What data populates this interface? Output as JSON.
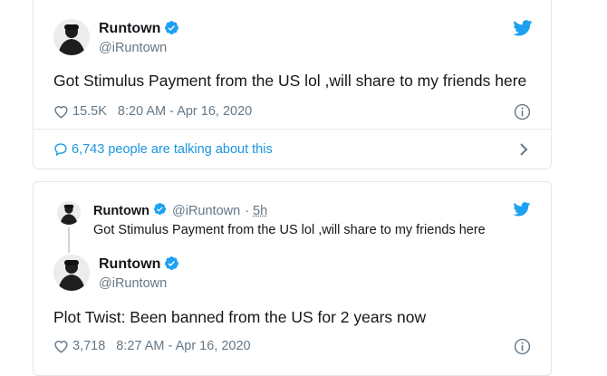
{
  "tweet1": {
    "name": "Runtown",
    "handle": "@iRuntown",
    "text": "Got Stimulus Payment from the US lol ,will share to my friends here",
    "likes": "15.5K",
    "timestamp": "8:20 AM - Apr 16, 2020",
    "talking": "6,743 people are talking about this"
  },
  "tweet2": {
    "quoted": {
      "name": "Runtown",
      "handle": "@iRuntown",
      "separator": "·",
      "time": "5h",
      "text": "Got Stimulus Payment from the US lol ,will share to my friends here"
    },
    "name": "Runtown",
    "handle": "@iRuntown",
    "text": "Plot Twist: Been banned from the US for 2 years now",
    "likes": "3,718",
    "timestamp": "8:27 AM - Apr 16, 2020"
  },
  "colors": {
    "twitter_blue": "#1da1f2",
    "link_blue": "#1b95e0",
    "gray_text": "#657786",
    "border": "#e1e8ed"
  },
  "icons": [
    "twitter-bird-icon",
    "verified-badge-icon",
    "heart-icon",
    "info-icon",
    "speech-bubble-icon",
    "chevron-right-icon"
  ]
}
